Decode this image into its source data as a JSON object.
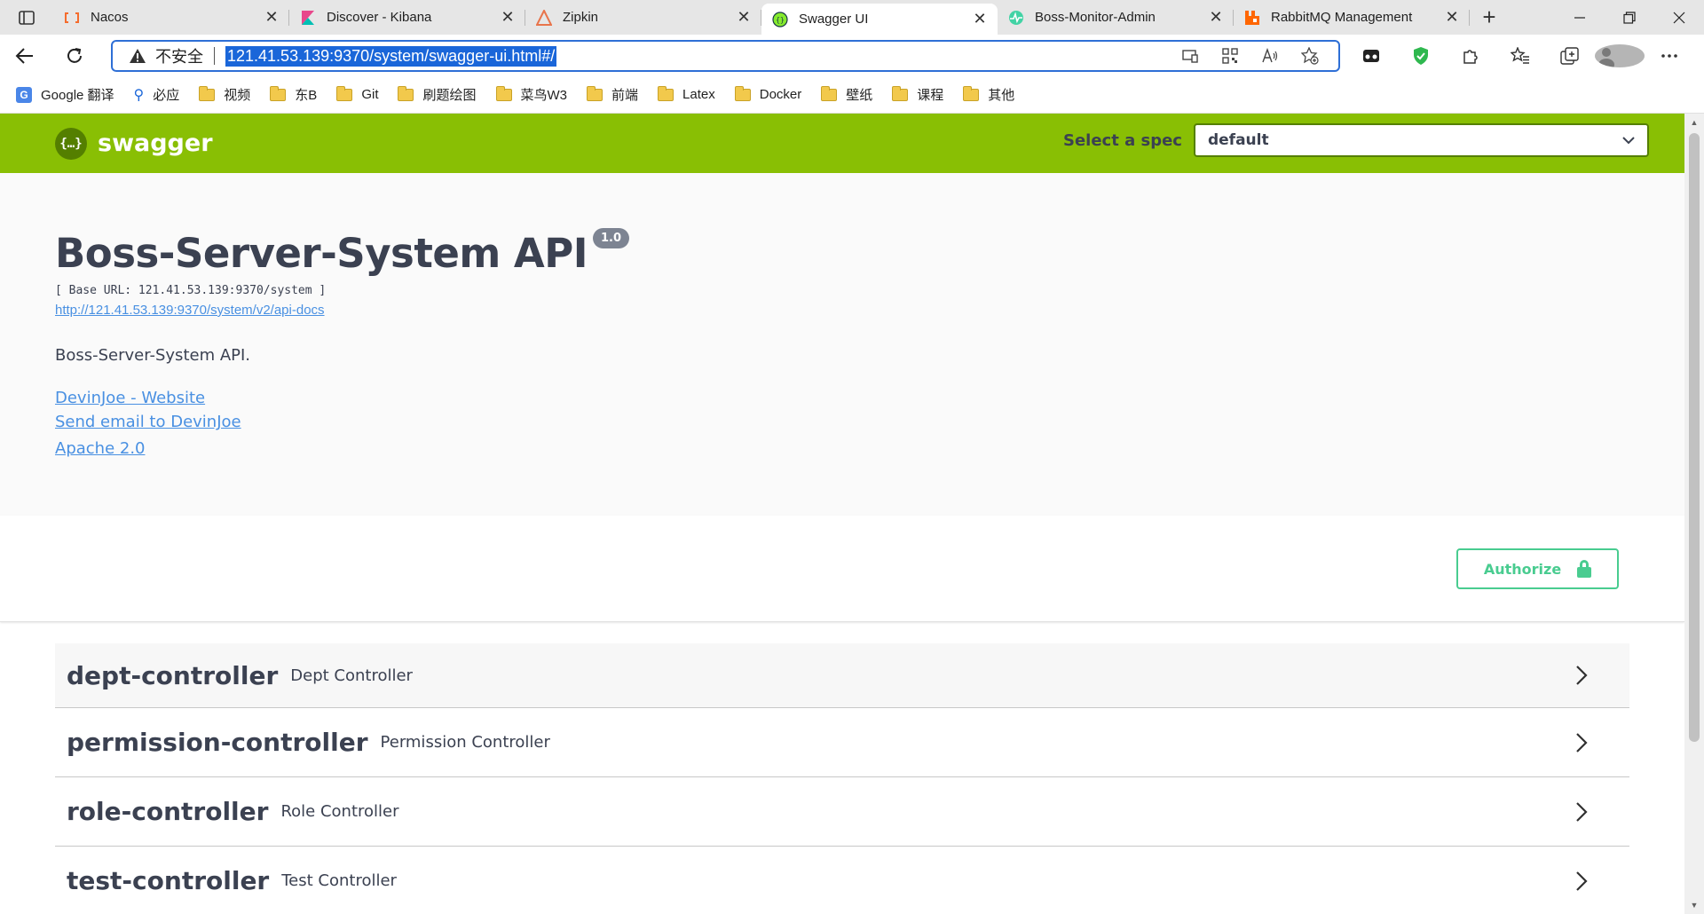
{
  "browser": {
    "tabs": [
      {
        "title": "Nacos",
        "icon": "nacos-icon",
        "active": false
      },
      {
        "title": "Discover - Kibana",
        "icon": "kibana-icon",
        "active": false
      },
      {
        "title": "Zipkin",
        "icon": "zipkin-icon",
        "active": false
      },
      {
        "title": "Swagger UI",
        "icon": "swagger-icon",
        "active": true
      },
      {
        "title": "Boss-Monitor-Admin",
        "icon": "monitor-icon",
        "active": false
      },
      {
        "title": "RabbitMQ Management",
        "icon": "rabbitmq-icon",
        "active": false
      }
    ],
    "close_glyph": "✕",
    "newtab_glyph": "+",
    "address": {
      "insecure_label": "不安全",
      "url": "121.41.53.139:9370/system/swagger-ui.html#/"
    },
    "bookmarks": [
      {
        "label": "Google 翻译",
        "type": "google"
      },
      {
        "label": "必应",
        "type": "bing"
      },
      {
        "label": "视频",
        "type": "folder"
      },
      {
        "label": "东B",
        "type": "folder"
      },
      {
        "label": "Git",
        "type": "folder"
      },
      {
        "label": "刷题绘图",
        "type": "folder"
      },
      {
        "label": "菜鸟W3",
        "type": "folder"
      },
      {
        "label": "前端",
        "type": "folder"
      },
      {
        "label": "Latex",
        "type": "folder"
      },
      {
        "label": "Docker",
        "type": "folder"
      },
      {
        "label": "壁纸",
        "type": "folder"
      },
      {
        "label": "课程",
        "type": "folder"
      },
      {
        "label": "其他",
        "type": "folder"
      }
    ]
  },
  "swagger": {
    "logo_text": "swagger",
    "spec_label": "Select a spec",
    "spec_value": "default",
    "title": "Boss-Server-System API",
    "version": "1.0",
    "base_url": "[ Base URL: 121.41.53.139:9370/system ]",
    "docs_url": "http://121.41.53.139:9370/system/v2/api-docs",
    "description": "Boss-Server-System API.",
    "contact_website": "DevinJoe - Website",
    "contact_email": "Send email to DevinJoe",
    "license": "Apache 2.0",
    "authorize_label": "Authorize",
    "tags": [
      {
        "name": "dept-controller",
        "desc": "Dept Controller"
      },
      {
        "name": "permission-controller",
        "desc": "Permission Controller"
      },
      {
        "name": "role-controller",
        "desc": "Role Controller"
      },
      {
        "name": "test-controller",
        "desc": "Test Controller"
      }
    ]
  },
  "colors": {
    "topbar": "#89bf04",
    "authorize": "#49cc90",
    "link": "#4990e2",
    "url_highlight": "#1a66d9"
  }
}
